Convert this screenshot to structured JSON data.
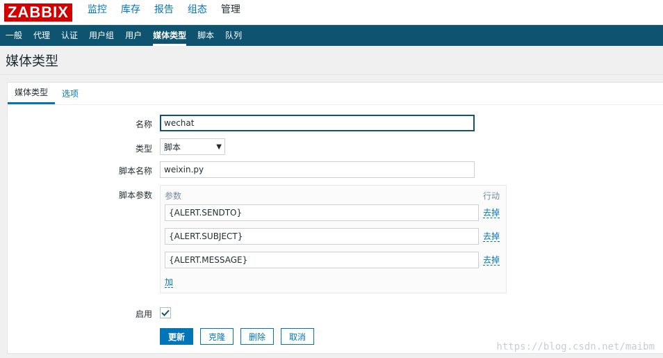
{
  "logo": "ZABBIX",
  "top_menu": [
    "监控",
    "库存",
    "报告",
    "组态",
    "管理"
  ],
  "sub_menu": [
    "一般",
    "代理",
    "认证",
    "用户组",
    "用户",
    "媒体类型",
    "脚本",
    "队列"
  ],
  "page_title": "媒体类型",
  "tabs": [
    "媒体类型",
    "选项"
  ],
  "form": {
    "name_label": "名称",
    "name_value": "wechat",
    "type_label": "类型",
    "type_value": "脚本",
    "script_name_label": "脚本名称",
    "script_name_value": "weixin.py",
    "script_params_label": "脚本参数",
    "params_col_header": "参数",
    "action_col_header": "行动",
    "params": [
      "{ALERT.SENDTO}",
      "{ALERT.SUBJECT}",
      "{ALERT.MESSAGE}"
    ],
    "remove_label": "去掉",
    "add_label": "加",
    "enabled_label": "启用",
    "enabled": true
  },
  "buttons": {
    "update": "更新",
    "clone": "克隆",
    "delete": "删除",
    "cancel": "取消"
  },
  "watermark": "https://blog.csdn.net/maibm",
  "colors": {
    "brand_red": "#d40000",
    "nav_dark": "#0e5471",
    "link_blue": "#0275b8"
  }
}
